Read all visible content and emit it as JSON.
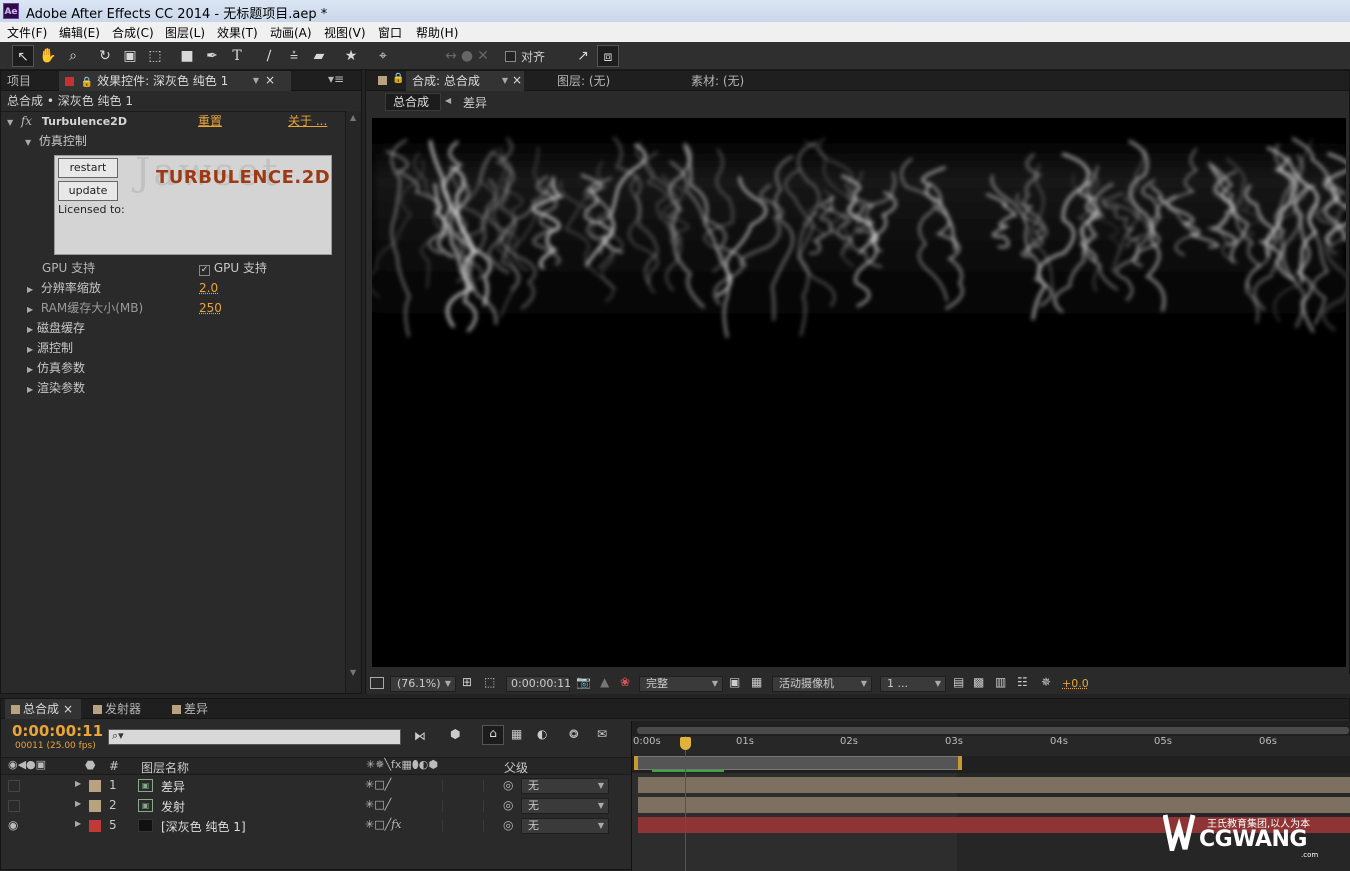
{
  "app": {
    "title": "Adobe After Effects CC 2014 - 无标题项目.aep *",
    "logo": "Ae"
  },
  "menu": [
    "文件(F)",
    "编辑(E)",
    "合成(C)",
    "图层(L)",
    "效果(T)",
    "动画(A)",
    "视图(V)",
    "窗口",
    "帮助(H)"
  ],
  "toolbar": {
    "align_label": "对齐"
  },
  "left_panel": {
    "tab_project": "项目",
    "tab_effects": "效果控件: 深灰色 纯色 1",
    "breadcrumb": "总合成 • 深灰色 纯色 1",
    "effect_name": "Turbulence2D",
    "reset": "重置",
    "about": "关于 ...",
    "sim_control": "仿真控制",
    "restart": "restart",
    "update": "update",
    "brand": "TURBULENCE.2D",
    "brand_bg": "Jawset",
    "licensed": "Licensed to:",
    "gpu_label": "GPU 支持",
    "gpu_check": "GPU 支持",
    "res_label": "分辨率缩放",
    "res_value": "2.0",
    "ram_label": "RAM缓存大小(MB)",
    "ram_value": "250",
    "groups": [
      "磁盘缓存",
      "源控制",
      "仿真参数",
      "渲染参数"
    ]
  },
  "comp_panel": {
    "tab_comp": "合成: 总合成",
    "tab_layer": "图层: (无)",
    "tab_footage": "素材: (无)",
    "crumb_main": "总合成",
    "crumb_sub": "差异",
    "zoom": "(76.1%)",
    "timecode": "0:00:00:11",
    "quality": "完整",
    "camera": "活动摄像机",
    "views": "1 ...",
    "exposure": "+0.0"
  },
  "timeline": {
    "tabs": [
      "总合成",
      "发射器",
      "差异"
    ],
    "timecode": "0:00:00:11",
    "frames": "00011 (25.00 fps)",
    "col_num": "#",
    "col_name": "图层名称",
    "col_parent": "父级",
    "ruler": [
      "0:00s",
      "01s",
      "02s",
      "03s",
      "04s",
      "05s",
      "06s"
    ],
    "layers": [
      {
        "num": "1",
        "name": "差异",
        "parent": "无",
        "color": "#b9a27f"
      },
      {
        "num": "2",
        "name": "发射",
        "parent": "无",
        "color": "#b9a27f"
      },
      {
        "num": "5",
        "name": "[深灰色 纯色 1]",
        "parent": "无",
        "color": "#c03a3a"
      }
    ]
  },
  "watermark": {
    "main": "CGWANG",
    "sub": "王氏教育集团,以人为本",
    "domain": ".com"
  }
}
